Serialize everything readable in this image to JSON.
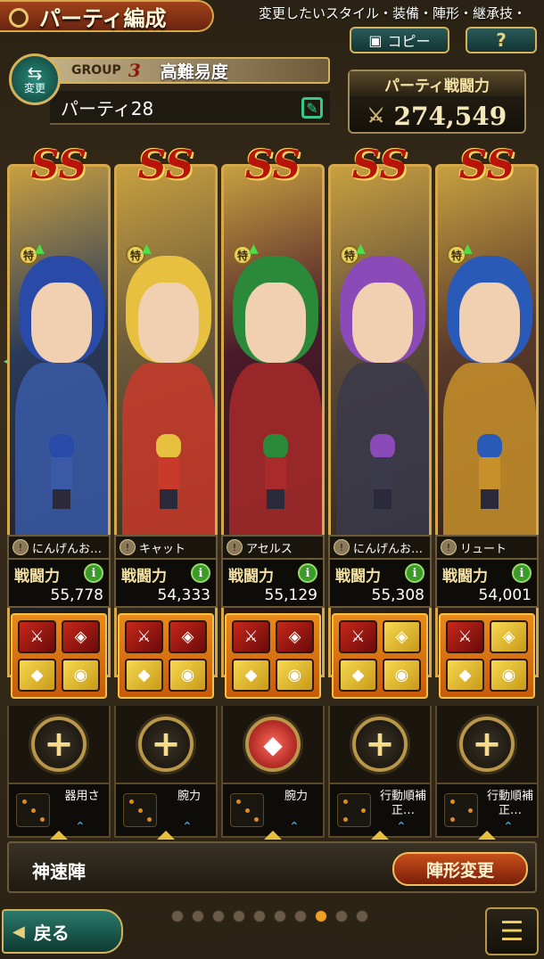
{
  "header": {
    "title": "パーティ編成",
    "ticker": "変更したいスタイル・装備・陣形・継承技・",
    "copy_label": "コピー",
    "help_label": "?"
  },
  "group": {
    "swap_label": "変更",
    "group_label": "GROUP",
    "group_number": "3",
    "group_name": "高難易度",
    "party_name": "パーティ28"
  },
  "party_power": {
    "label": "パーティ戦闘力",
    "value": "274,549"
  },
  "stat_label": "戦闘力",
  "characters": [
    {
      "rank": "SS",
      "name": "にんげんお…",
      "power": "55,778",
      "skill": "器用さ",
      "hair": "#2a4aa8",
      "body": "#3a5aa8",
      "bg": "#2a3a5a",
      "equip": [
        "red",
        "red",
        "gold",
        "gold"
      ],
      "skill_btn": "plus"
    },
    {
      "rank": "SS",
      "name": "キャット",
      "power": "54,333",
      "skill": "腕力",
      "hair": "#e8c040",
      "body": "#c83a2a",
      "bg": "#6a5a3a",
      "equip": [
        "red",
        "red",
        "gold",
        "gold"
      ],
      "skill_btn": "plus"
    },
    {
      "rank": "SS",
      "name": "アセルス",
      "power": "55,129",
      "skill": "腕力",
      "hair": "#2a8a3a",
      "body": "#a82a2a",
      "bg": "#4a1a2a",
      "equip": [
        "red",
        "red",
        "gold",
        "gold"
      ],
      "skill_btn": "red"
    },
    {
      "rank": "SS",
      "name": "にんげんお…",
      "power": "55,308",
      "skill": "行動順補正…",
      "hair": "#8a4ab8",
      "body": "#3a3a4a",
      "bg": "#5a4a3a",
      "equip": [
        "red",
        "gold",
        "gold",
        "gold"
      ],
      "skill_btn": "plus"
    },
    {
      "rank": "SS",
      "name": "リュート",
      "power": "54,001",
      "skill": "行動順補正…",
      "hair": "#2a5ab8",
      "body": "#c8902a",
      "bg": "#5a3a2a",
      "equip": [
        "red",
        "gold",
        "gold",
        "gold"
      ],
      "skill_btn": "plus"
    }
  ],
  "formation": {
    "name": "神速陣",
    "change_label": "陣形変更"
  },
  "footer": {
    "back_label": "戻る",
    "page_count": 10,
    "active_page": 8
  }
}
